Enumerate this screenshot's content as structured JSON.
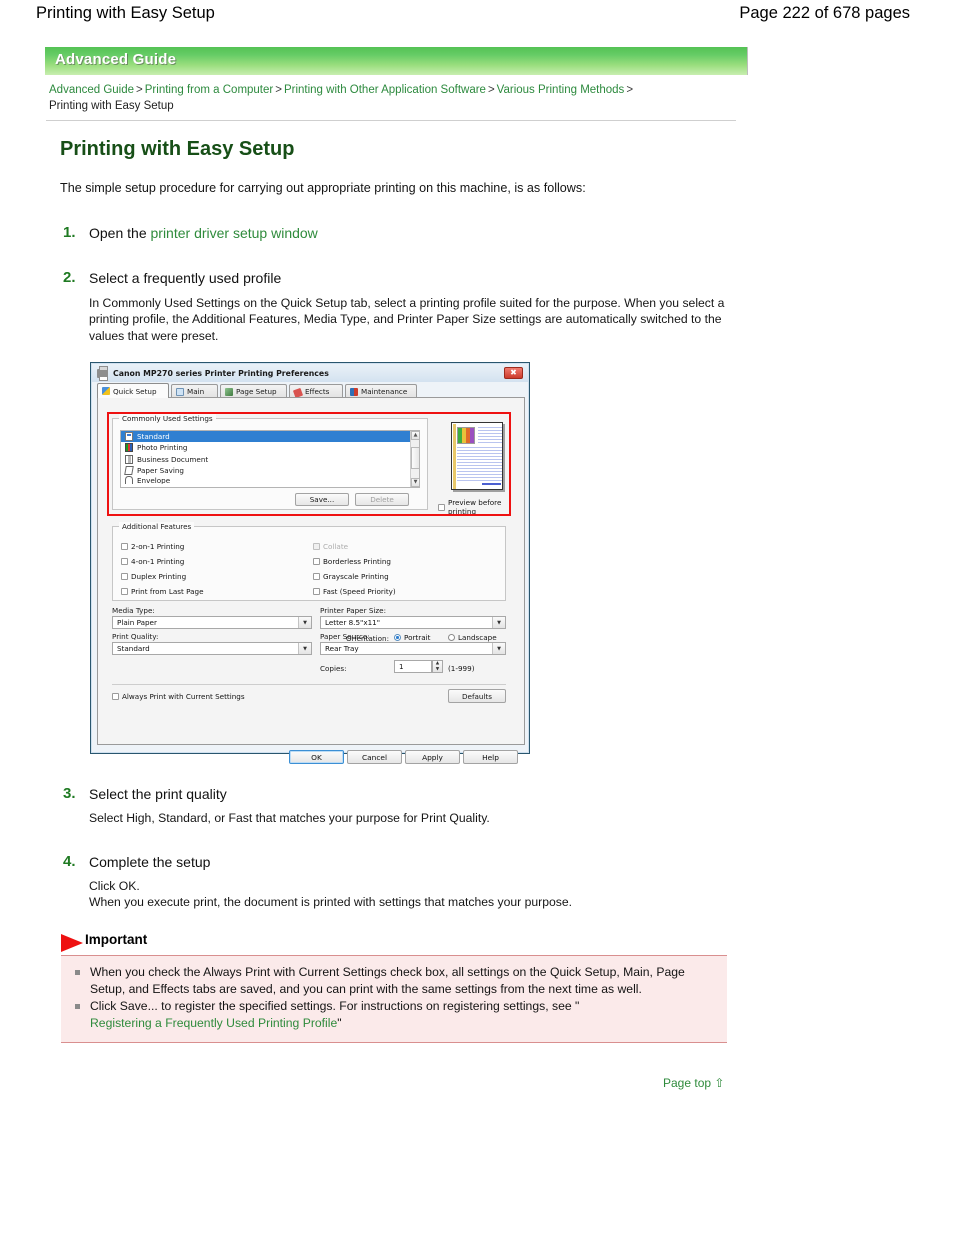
{
  "header": {
    "title": "Printing with Easy Setup",
    "page_info": "Page 222 of 678 pages"
  },
  "banner": {
    "label": "Advanced Guide"
  },
  "breadcrumb": {
    "items": [
      "Advanced Guide",
      "Printing from a Computer",
      "Printing with Other Application Software",
      "Various Printing Methods"
    ],
    "separator": ">",
    "current": "Printing with Easy Setup"
  },
  "doc": {
    "title": "Printing with Easy Setup",
    "intro": "The simple setup procedure for carrying out appropriate printing on this machine, is as follows:"
  },
  "steps": [
    {
      "num": "1.",
      "head_prefix": "Open the ",
      "head_link": "printer driver setup window",
      "body": ""
    },
    {
      "num": "2.",
      "head": "Select a frequently used profile",
      "body": "In Commonly Used Settings on the Quick Setup tab, select a printing profile suited for the purpose. When you select a printing profile, the Additional Features, Media Type, and Printer Paper Size settings are automatically switched to the values that were preset."
    },
    {
      "num": "3.",
      "head": "Select the print quality",
      "body": "Select High, Standard, or Fast that matches your purpose for Print Quality."
    },
    {
      "num": "4.",
      "head": "Complete the setup",
      "body_line1": "Click OK.",
      "body_line2": "When you execute print, the document is printed with settings that matches your purpose."
    }
  ],
  "important": {
    "title": "Important",
    "item1": "When you check the Always Print with Current Settings check box, all settings on the Quick Setup, Main, Page Setup, and Effects tabs are saved, and you can print with the same settings from the next time as well.",
    "item2_prefix": "Click Save... to register the specified settings. For instructions on registering settings, see \"",
    "item2_link": "Registering a Frequently Used Printing Profile",
    "item2_suffix": "\""
  },
  "page_top": {
    "label": "Page top",
    "arrow": "⇧"
  },
  "dialog": {
    "title": "Canon MP270 series Printer Printing Preferences",
    "close_label": "✖",
    "tabs": [
      {
        "label": "Quick Setup",
        "icon": "quick-setup-icon",
        "active": true
      },
      {
        "label": "Main",
        "icon": "main-icon",
        "active": false
      },
      {
        "label": "Page Setup",
        "icon": "page-setup-icon",
        "active": false
      },
      {
        "label": "Effects",
        "icon": "effects-icon",
        "active": false
      },
      {
        "label": "Maintenance",
        "icon": "maintenance-icon",
        "active": false
      }
    ],
    "commonly_used": {
      "group_label": "Commonly Used Settings",
      "items": [
        {
          "label": "Standard",
          "selected": true
        },
        {
          "label": "Photo Printing",
          "selected": false
        },
        {
          "label": "Business Document",
          "selected": false
        },
        {
          "label": "Paper Saving",
          "selected": false
        },
        {
          "label": "Envelope",
          "selected": false
        }
      ],
      "save_button": "Save...",
      "delete_button": "Delete"
    },
    "preview": {
      "checkbox_label": "Preview before printing",
      "checked": false
    },
    "additional_features": {
      "group_label": "Additional Features",
      "left": [
        {
          "label": "2-on-1 Printing",
          "checked": false,
          "disabled": false
        },
        {
          "label": "4-on-1 Printing",
          "checked": false,
          "disabled": false
        },
        {
          "label": "Duplex Printing",
          "checked": false,
          "disabled": false
        },
        {
          "label": "Print from Last Page",
          "checked": false,
          "disabled": false
        }
      ],
      "right": [
        {
          "label": "Collate",
          "checked": false,
          "disabled": true
        },
        {
          "label": "Borderless Printing",
          "checked": false,
          "disabled": false
        },
        {
          "label": "Grayscale Printing",
          "checked": false,
          "disabled": false
        },
        {
          "label": "Fast (Speed Priority)",
          "checked": false,
          "disabled": false
        }
      ]
    },
    "fields": {
      "media_type_label": "Media Type:",
      "media_type_value": "Plain Paper",
      "paper_size_label": "Printer Paper Size:",
      "paper_size_value": "Letter 8.5\"x11\"",
      "orientation_label": "Orientation:",
      "orientation_portrait": "Portrait",
      "orientation_landscape": "Landscape",
      "orientation_selected": "Portrait",
      "print_quality_label": "Print Quality:",
      "print_quality_value": "Standard",
      "paper_source_label": "Paper Source:",
      "paper_source_value": "Rear Tray",
      "copies_label": "Copies:",
      "copies_value": "1",
      "copies_range": "(1-999)"
    },
    "always_print_label": "Always Print with Current Settings",
    "defaults_button": "Defaults",
    "footer_buttons": [
      "OK",
      "Cancel",
      "Apply",
      "Help"
    ]
  },
  "colors": {
    "link_green": "#2f8b3c",
    "heading_green": "#174f17",
    "banner_green": "#66cc66",
    "important_bg": "#fbeaea",
    "annotation_red": "#ee1111",
    "selection_blue": "#2f7fd1"
  }
}
